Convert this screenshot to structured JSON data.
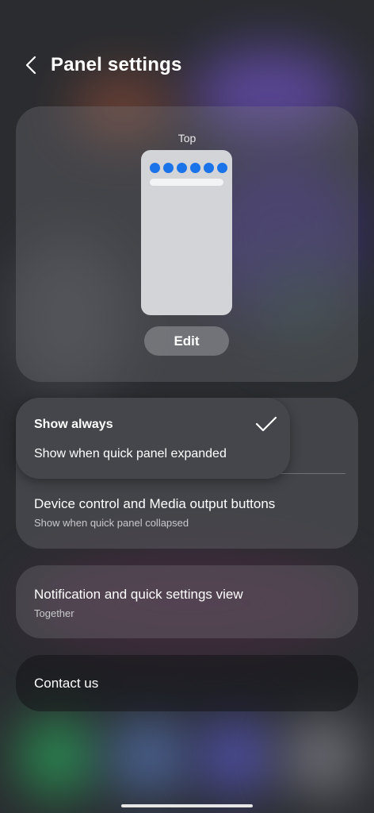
{
  "header": {
    "title": "Panel settings"
  },
  "preview": {
    "position_label": "Top",
    "edit_label": "Edit",
    "dot_count": 6,
    "dot_color": "#1a73e8"
  },
  "dropdown": {
    "options": [
      {
        "label": "Show always",
        "selected": true
      },
      {
        "label": "Show when quick panel expanded",
        "selected": false
      }
    ]
  },
  "settings": {
    "device_control": {
      "title": "Device control and Media output buttons",
      "value": "Show when quick panel collapsed"
    },
    "notification_view": {
      "title": "Notification and quick settings view",
      "value": "Together"
    },
    "contact": {
      "label": "Contact us"
    }
  },
  "icons": {
    "back": "back-arrow-icon",
    "check": "check-icon"
  }
}
